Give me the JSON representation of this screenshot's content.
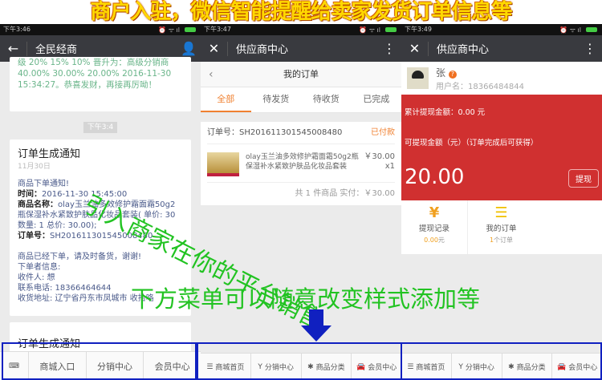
{
  "banner": "商户入驻，微信智能提醒给卖家发货订单信息等",
  "overlay": {
    "diagonal": "引入商家在你的平台销售",
    "menu_note": "下方菜单可以随意改变样式添加等"
  },
  "phone1": {
    "time": "下午3:46",
    "title": "全民经商",
    "prev_msg": "级 20% 15% 10% 晋升为：高级分销商 40.00% 30.00% 20.00% 2016-11-30 15:34:27。恭喜发财，再接再厉呦！",
    "time_chip": "下午3:4",
    "card": {
      "title": "订单生成通知",
      "date": "11月30日",
      "l1": "商品下单通知!",
      "time_label": "时间：",
      "time_val": "2016-11-30 15:45:00",
      "name_label": "商品名称：",
      "name_val": "olay玉兰油多效修护霜面霜50g2瓶保湿补水紧致护肤品化妆品套装( 单价: 30 数量: 1 总价: 30.00);",
      "order_label": "订单号：",
      "order_val": "SH201611301545008480",
      "l5": "商品已经下单，请及时备货，谢谢!",
      "l6": "下单者信息:",
      "l7": "收件人: 想",
      "l8": "联系电话: 18366464644",
      "l9": "收货地址: 辽宁省丹东市凤城市 收拾咯"
    },
    "card2_title": "订单生成通知",
    "menu": [
      "商城入口",
      "分销中心",
      "会员中心"
    ]
  },
  "phone2": {
    "time": "下午3:47",
    "title": "供应商中心",
    "sub_title": "我的订单",
    "tabs": [
      "全部",
      "待发货",
      "待收货",
      "已完成"
    ],
    "order": {
      "no": "订单号：SH201611301545008480",
      "status": "已付款",
      "product": "olay玉兰油多效修护霜面霜50g2瓶 保湿补水紧致护肤品化妆品套装",
      "price": "￥30.00",
      "qty": "x1",
      "summary": "共 1 件商品 实付：￥30.00"
    },
    "menu": [
      "商城首页",
      "分销中心",
      "商品分类",
      "会员中心"
    ]
  },
  "phone3": {
    "time": "下午3:49",
    "title": "供应商中心",
    "name": "张",
    "username": "用户名：18366484844",
    "total": "累计提现金额：0.00 元",
    "avail_label": "可提现金额（元）（订单完成后可获得）",
    "amount": "20.00",
    "withdraw": "提现",
    "stats": [
      {
        "label": "提现记录",
        "value": "0.00",
        "unit": "元"
      },
      {
        "label": "我的订单",
        "value": "1",
        "unit": "个订单"
      }
    ],
    "menu": [
      "商城首页",
      "分销中心",
      "商品分类",
      "会员中心"
    ]
  },
  "colors": {
    "red": "#d03030",
    "orange": "#f08030",
    "green": "#22c322",
    "blue": "#1020c0"
  }
}
